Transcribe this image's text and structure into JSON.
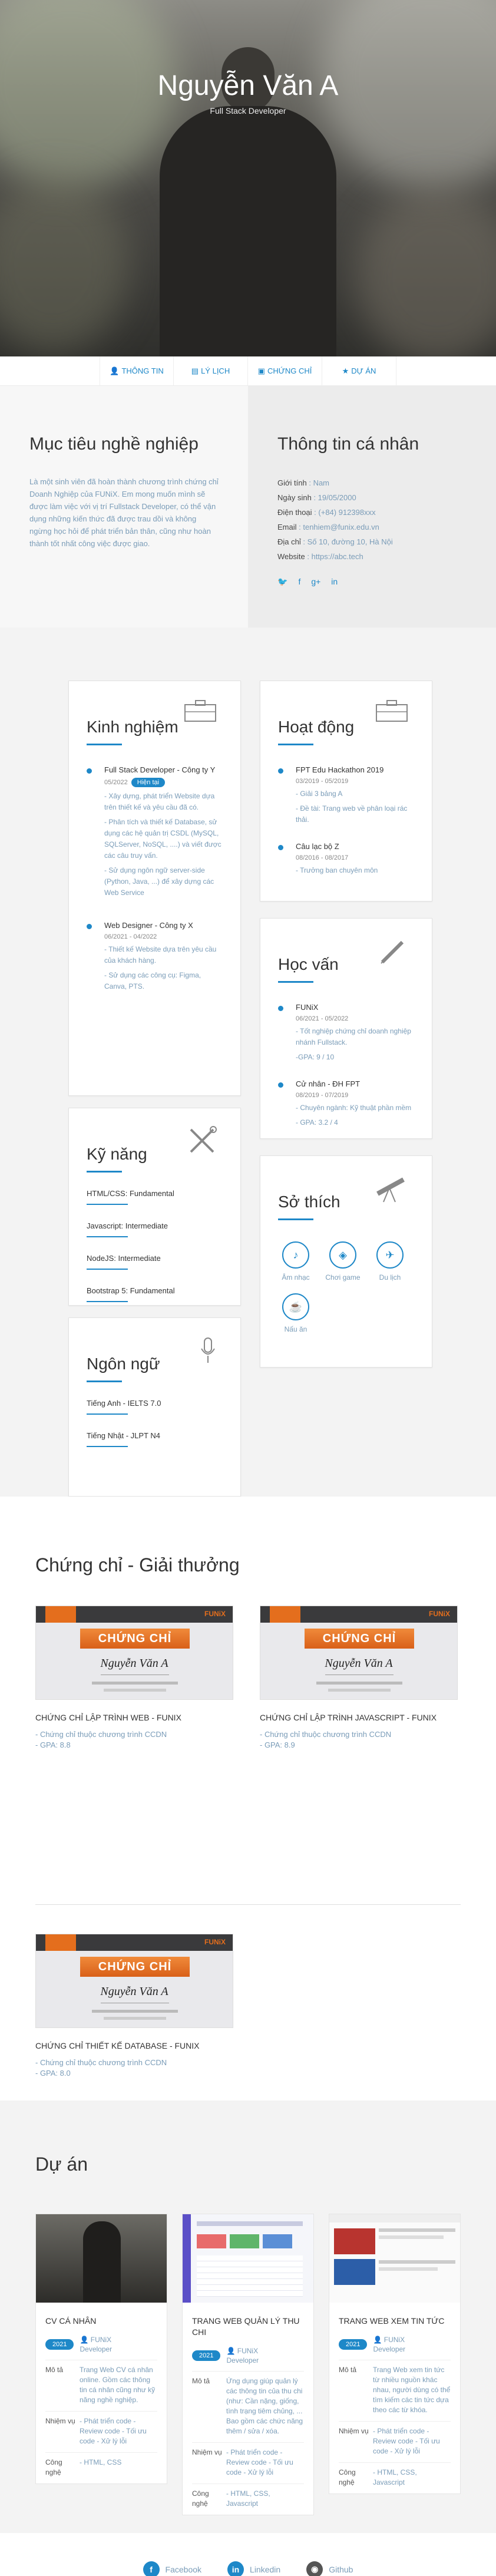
{
  "hero": {
    "name": "Nguyễn Văn A",
    "subtitle": "Full Stack Developer"
  },
  "nav": [
    {
      "icon": "user-icon",
      "label": "THÔNG TIN"
    },
    {
      "icon": "file-icon",
      "label": "LÝ LỊCH"
    },
    {
      "icon": "certificate-icon",
      "label": "CHỨNG CHỈ"
    },
    {
      "icon": "star-icon",
      "label": "DỰ ÁN"
    }
  ],
  "objective": {
    "title": "Mục tiêu nghề nghiệp",
    "text": "Là một sinh viên đã hoàn thành chương trình chứng chỉ Doanh Nghiệp của FUNiX. Em mong muốn mình sẽ được làm việc với vị trí Fullstack Developer, có thể vận dụng những kiến thức đã được trau dồi và không ngừng học hỏi để phát triển bản thân, cũng như hoàn thành tốt nhất công việc được giao."
  },
  "personal": {
    "title": "Thông tin cá nhân",
    "rows": [
      {
        "k": "Giới tính",
        "v": ": Nam"
      },
      {
        "k": "Ngày sinh",
        "v": ": 19/05/2000"
      },
      {
        "k": "Điện thoại",
        "v": ": (+84) 912398xxx"
      },
      {
        "k": "Email",
        "v": ": tenhiem@funix.edu.vn"
      },
      {
        "k": "Địa chỉ",
        "v": ": Số 10, đường 10, Hà Nội"
      },
      {
        "k": "Website",
        "v": ": https://abc.tech"
      }
    ],
    "socials": [
      "twitter-icon",
      "facebook-icon",
      "google-plus-icon",
      "linkedin-icon"
    ]
  },
  "experience": {
    "title": "Kinh nghiệm",
    "items": [
      {
        "title": "Full Stack Developer - Công ty Y",
        "date": "05/2022",
        "pill": "Hiện tại",
        "bullets": [
          "- Xây dựng, phát triển Website dựa trên thiết kế và yêu cầu đã có.",
          "- Phân tích và thiết kế Database, sử dụng các hệ quản trị CSDL (MySQL, SQLServer, NoSQL, ....) và viết được các câu truy vấn.",
          "- Sử dụng ngôn ngữ server-side (Python, Java, ...) để xây dựng các Web Service"
        ]
      },
      {
        "title": "Web Designer - Công ty X",
        "date": "06/2021 - 04/2022",
        "pill": "",
        "bullets": [
          "- Thiết kế Website dựa trên yêu cầu của khách hàng.",
          "- Sử dụng các công cụ: Figma, Canva, PTS."
        ]
      }
    ]
  },
  "activities": {
    "title": "Hoạt động",
    "items": [
      {
        "title": "FPT Edu Hackathon 2019",
        "date": "03/2019 - 05/2019",
        "bullets": [
          "- Giải 3 bảng A",
          "- Đề tài: Trang web về phân loại rác thải."
        ]
      },
      {
        "title": "Câu lạc bộ Z",
        "date": "08/2016 - 08/2017",
        "bullets": [
          "- Trưởng ban chuyên môn"
        ]
      }
    ]
  },
  "skills": {
    "title": "Kỹ năng",
    "items": [
      "HTML/CSS: Fundamental",
      "Javascript: Intermediate",
      "NodeJS: Intermediate",
      "Bootstrap 5: Fundamental"
    ]
  },
  "education": {
    "title": "Học vấn",
    "items": [
      {
        "title": "FUNiX",
        "date": "06/2021 - 05/2022",
        "bullets": [
          "- Tốt nghiệp chứng chỉ doanh nghiệp nhánh Fullstack.",
          "-GPA: 9 / 10"
        ]
      },
      {
        "title": "Cử nhân - ĐH FPT",
        "date": "08/2019 - 07/2019",
        "bullets": [
          "- Chuyên ngành: Kỹ thuật phần mềm",
          "- GPA: 3.2 / 4"
        ]
      }
    ]
  },
  "languages": {
    "title": "Ngôn ngữ",
    "items": [
      "Tiếng Anh - IELTS 7.0",
      "Tiếng Nhật - JLPT N4"
    ]
  },
  "hobbies": {
    "title": "Sở thích",
    "items": [
      {
        "icon": "music-icon",
        "label": "Âm nhạc"
      },
      {
        "icon": "game-icon",
        "label": "Chơi game"
      },
      {
        "icon": "travel-icon",
        "label": "Du lịch"
      },
      {
        "icon": "cooking-icon",
        "label": "Nấu ăn"
      }
    ]
  },
  "certs": {
    "title": "Chứng chỉ - Giải thưởng",
    "image": {
      "brand": "FUNiX",
      "ribbon": "CHỨNG CHỈ",
      "name": "Nguyễn Văn A"
    },
    "items": [
      {
        "title": "CHỨNG CHỈ LẬP TRÌNH WEB - FUNIX",
        "desc": "- Chứng chỉ thuộc chương trình CCDN",
        "gpa": "- GPA: 8.8"
      },
      {
        "title": "CHỨNG CHỈ LẬP TRÌNH JAVASCRIPT - FUNIX",
        "desc": "- Chứng chỉ thuộc chương trình CCDN",
        "gpa": "- GPA: 8.9"
      },
      {
        "title": "CHỨNG CHỈ THIẾT KẾ DATABASE - FUNIX",
        "desc": "- Chứng chỉ thuộc chương trình CCDN",
        "gpa": "- GPA: 8.0"
      }
    ]
  },
  "projects": {
    "title": "Dự án",
    "labels": {
      "desc": "Mô tả",
      "role": "Nhiệm vụ",
      "tech": "Công nghệ"
    },
    "items": [
      {
        "title": "CV CÁ NHÂN",
        "year": "2021",
        "org": "FUNiX",
        "role_title": "Developer",
        "desc": "Trang Web CV cá nhân online. Gồm các thông tin cá nhân cũng như kỹ năng nghề nghiệp.",
        "role": "- Phát triển code - Review code - Tối ưu code - Xử lý lỗi",
        "tech": "- HTML, CSS"
      },
      {
        "title": "TRANG WEB QUẢN LÝ THU CHI",
        "year": "2021",
        "org": "FUNiX",
        "role_title": "Developer",
        "desc": "Ứng dụng giúp quản lý các thông tin của thu chi (như: Cần nặng, giống, tình trạng tiêm chủng, ... Bao gồm các chức năng thêm / sửa / xóa.",
        "role": "- Phát triển code - Review code - Tối ưu code - Xử lý lỗi",
        "tech": "- HTML, CSS, Javascript"
      },
      {
        "title": "TRANG WEB XEM TIN TỨC",
        "year": "2021",
        "org": "FUNiX",
        "role_title": "Developer",
        "desc": "Trang Web xem tin tức từ nhiều nguồn khác nhau, người dùng có thể tìm kiếm các tin tức dựa theo các từ khóa.",
        "role": "- Phát triển code - Review code - Tối ưu code - Xử lý lỗi",
        "tech": "- HTML, CSS, Javascript"
      }
    ]
  },
  "footer": [
    {
      "icon": "facebook-icon",
      "label": "Facebook"
    },
    {
      "icon": "linkedin-icon",
      "label": "Linkedin"
    },
    {
      "icon": "github-icon",
      "label": "Github"
    }
  ],
  "colors": {
    "accent": "#1e88c8",
    "muted_text": "#7a9cb8"
  }
}
